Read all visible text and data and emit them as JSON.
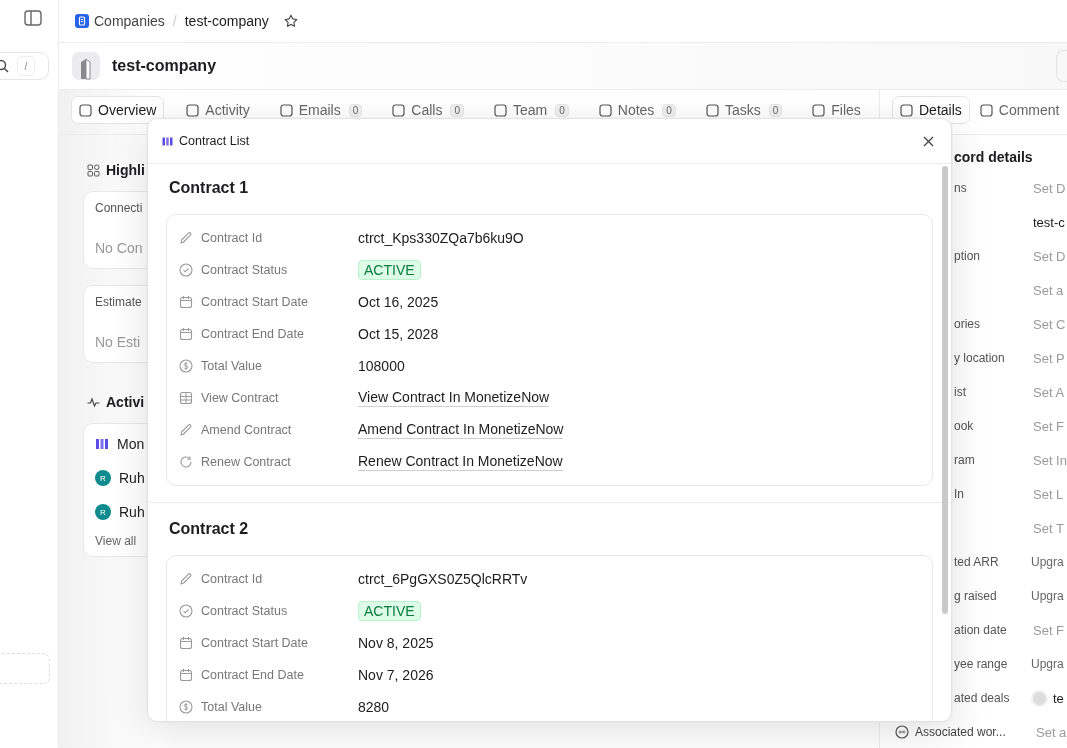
{
  "breadcrumb": {
    "section": "Companies",
    "separator": "/",
    "record": "test-company"
  },
  "search": {
    "shortcut": "/"
  },
  "header": {
    "title": "test-company"
  },
  "tabs": [
    {
      "label": "Overview",
      "selected": true
    },
    {
      "label": "Activity",
      "selected": false
    },
    {
      "label": "Emails",
      "count": "0",
      "selected": false
    },
    {
      "label": "Calls",
      "count": "0",
      "selected": false
    },
    {
      "label": "Team",
      "count": "0",
      "selected": false
    },
    {
      "label": "Notes",
      "count": "0",
      "selected": false
    },
    {
      "label": "Tasks",
      "count": "0",
      "selected": false
    },
    {
      "label": "Files",
      "selected": false
    }
  ],
  "side_tabs": [
    {
      "label": "Details",
      "selected": true
    },
    {
      "label": "Comment",
      "selected": false
    }
  ],
  "highlights": {
    "title": "Highli",
    "cards": [
      {
        "label": "Connecti",
        "value": "No Con"
      },
      {
        "label": "Estimate",
        "value": "No Esti"
      }
    ]
  },
  "activity": {
    "title": "Activi",
    "items": [
      {
        "kind": "app",
        "text": "Mon"
      },
      {
        "kind": "person",
        "initial": "R",
        "text": "Ruh"
      },
      {
        "kind": "person",
        "initial": "R",
        "text": "Ruh"
      }
    ],
    "view_all": "View all"
  },
  "details": {
    "title": "cord details",
    "rows": [
      {
        "label": "ns",
        "placeholder": "Set D",
        "kind": "empty"
      },
      {
        "label": "",
        "value": "test-c",
        "kind": "text"
      },
      {
        "label": "ption",
        "placeholder": "Set D",
        "kind": "empty"
      },
      {
        "label": "",
        "placeholder": "Set a",
        "kind": "empty"
      },
      {
        "label": "ories",
        "placeholder": "Set C",
        "kind": "empty"
      },
      {
        "label": "y location",
        "placeholder": "Set P",
        "kind": "empty"
      },
      {
        "label": "ist",
        "placeholder": "Set A",
        "kind": "empty"
      },
      {
        "label": "ook",
        "placeholder": "Set F",
        "kind": "empty"
      },
      {
        "label": "ram",
        "placeholder": "Set In",
        "kind": "empty"
      },
      {
        "label": "In",
        "placeholder": "Set L",
        "kind": "empty"
      },
      {
        "label": "",
        "placeholder": "Set T",
        "kind": "empty"
      },
      {
        "label": "ted ARR",
        "value": "Upgra",
        "kind": "upgrade"
      },
      {
        "label": "g raised",
        "value": "Upgra",
        "kind": "upgrade"
      },
      {
        "label": "ation date",
        "placeholder": "Set F",
        "kind": "empty"
      },
      {
        "label": "yee range",
        "value": "Upgra",
        "kind": "upgrade"
      },
      {
        "label": "ated deals",
        "value": "te",
        "kind": "deal"
      }
    ],
    "footer_row": {
      "label": "Associated wor...",
      "placeholder": "Set a"
    }
  },
  "modal": {
    "title": "Contract List",
    "contracts": [
      {
        "title": "Contract 1",
        "fields": [
          {
            "kind": "id",
            "label": "Contract Id",
            "value": "ctrct_Kps330ZQa7b6ku9O"
          },
          {
            "kind": "status",
            "label": "Contract Status",
            "value": "ACTIVE"
          },
          {
            "kind": "date",
            "label": "Contract Start Date",
            "value": "Oct 16, 2025"
          },
          {
            "kind": "date",
            "label": "Contract End Date",
            "value": "Oct 15, 2028"
          },
          {
            "kind": "amount",
            "label": "Total Value",
            "value": "108000"
          },
          {
            "kind": "view",
            "label": "View Contract",
            "value": "View Contract In MonetizeNow"
          },
          {
            "kind": "amend",
            "label": "Amend Contract",
            "value": "Amend Contract In MonetizeNow"
          },
          {
            "kind": "renew",
            "label": "Renew Contract",
            "value": "Renew Contract In MonetizeNow"
          }
        ]
      },
      {
        "title": "Contract 2",
        "fields": [
          {
            "kind": "id",
            "label": "Contract Id",
            "value": "ctrct_6PgGXS0Z5QlcRRTv"
          },
          {
            "kind": "status",
            "label": "Contract Status",
            "value": "ACTIVE"
          },
          {
            "kind": "date",
            "label": "Contract Start Date",
            "value": "Nov 8, 2025"
          },
          {
            "kind": "date",
            "label": "Contract End Date",
            "value": "Nov 7, 2026"
          },
          {
            "kind": "amount",
            "label": "Total Value",
            "value": "8280"
          }
        ]
      }
    ]
  }
}
